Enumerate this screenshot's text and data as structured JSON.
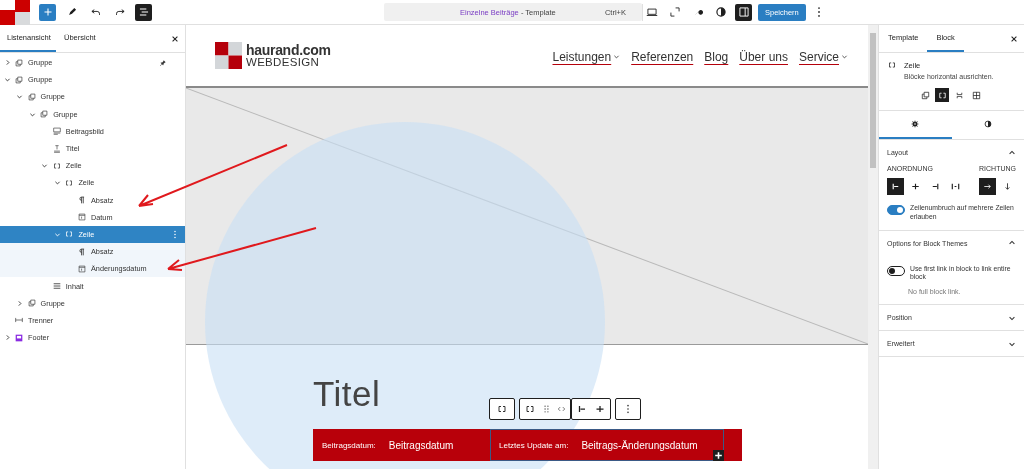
{
  "top_bar": {
    "left_tools": [
      {
        "kind": "add",
        "pressed": false
      },
      {
        "kind": "edit",
        "pressed": false
      },
      {
        "kind": "undo",
        "pressed": false
      },
      {
        "kind": "redo",
        "pressed": false
      },
      {
        "kind": "list_view",
        "pressed": true
      }
    ],
    "command": {
      "name": "Einzelne Beiträge",
      "type": "- Template",
      "shortcut": "Ctrl+K"
    },
    "right_tools": [
      {
        "kind": "desktop",
        "pressed": false
      },
      {
        "kind": "external",
        "pressed": false
      },
      {
        "kind": "tools",
        "pressed": false
      },
      {
        "kind": "styles",
        "pressed": false
      },
      {
        "kind": "sidebar",
        "pressed": true
      }
    ],
    "save": "Speichern"
  },
  "list_panel": {
    "tabs": [
      {
        "label": "Listenansicht",
        "selected": true
      },
      {
        "label": "Übersicht",
        "selected": false
      }
    ],
    "tree": [
      {
        "label": "Gruppe",
        "kind": "group",
        "expanded": false,
        "selected": false,
        "pinned": true
      },
      {
        "label": "Gruppe",
        "kind": "group",
        "expanded": true,
        "selected": false,
        "pinned": false,
        "children": [
          {
            "label": "Gruppe",
            "kind": "group",
            "expanded": true,
            "selected": false,
            "children": [
              {
                "label": "Gruppe",
                "kind": "group",
                "expanded": true,
                "selected": false,
                "children": [
                  {
                    "label": "Beitragsbild",
                    "kind": "image",
                    "selected": false
                  },
                  {
                    "label": "Titel",
                    "kind": "title",
                    "selected": false
                  },
                  {
                    "label": "Zeile",
                    "kind": "row",
                    "expanded": true,
                    "selected": false,
                    "children": [
                      {
                        "label": "Zeile",
                        "kind": "row",
                        "expanded": true,
                        "selected": false,
                        "children": [
                          {
                            "label": "Absatz",
                            "kind": "paragraph",
                            "selected": false
                          },
                          {
                            "label": "Datum",
                            "kind": "date",
                            "selected": false
                          }
                        ]
                      },
                      {
                        "label": "Zeile",
                        "kind": "row",
                        "expanded": true,
                        "selected": true,
                        "children": [
                          {
                            "label": "Absatz",
                            "kind": "paragraph",
                            "selected": false
                          },
                          {
                            "label": "Änderungsdatum",
                            "kind": "date",
                            "selected": false
                          }
                        ]
                      }
                    ]
                  },
                  {
                    "label": "Inhalt",
                    "kind": "content",
                    "selected": false
                  }
                ]
              }
            ]
          },
          {
            "label": "Gruppe",
            "kind": "group",
            "expanded": false,
            "selected": false
          }
        ]
      },
      {
        "label": "Trenner",
        "kind": "separator",
        "selected": false,
        "pinned": false
      },
      {
        "label": "Footer",
        "kind": "footer",
        "expanded": false,
        "selected": false,
        "pinned": false
      }
    ]
  },
  "canvas": {
    "site": {
      "logo_name": "haurand.com",
      "logo_tagline": "WEBDESIGN",
      "nav": [
        {
          "label": "Leistungen",
          "submenu": true
        },
        {
          "label": "Referenzen",
          "submenu": false
        },
        {
          "label": "Blog",
          "submenu": false
        },
        {
          "label": "Über uns",
          "submenu": false
        },
        {
          "label": "Service",
          "submenu": true
        }
      ]
    },
    "post": {
      "title": "Titel",
      "meta": [
        {
          "label": "Beitragsdatum:",
          "value": "Beitragsdatum",
          "selected": false
        },
        {
          "label": "Letztes Update am:",
          "value": "Beitrags-Änderungsdatum",
          "selected": true
        }
      ]
    }
  },
  "sidebar": {
    "tabs": [
      {
        "label": "Template",
        "selected": false
      },
      {
        "label": "Block",
        "selected": true
      }
    ],
    "block": {
      "name": "Zeile",
      "description": "Blöcke horizontal ausrichten."
    },
    "variations": [
      {
        "kind": "group",
        "selected": false
      },
      {
        "kind": "row",
        "selected": true
      },
      {
        "kind": "stack",
        "selected": false
      },
      {
        "kind": "grid",
        "selected": false
      }
    ],
    "inspector_tabs": [
      {
        "kind": "settings",
        "selected": true
      },
      {
        "kind": "styles",
        "selected": false
      }
    ],
    "panels": [
      {
        "kind": "layout",
        "title": "Layout",
        "expanded": true,
        "justification": {
          "label": "ANORDNUNG",
          "options": [
            {
              "kind": "left",
              "selected": true
            },
            {
              "kind": "center",
              "selected": false
            },
            {
              "kind": "right",
              "selected": false
            },
            {
              "kind": "space_between",
              "selected": false
            }
          ]
        },
        "orientation": {
          "label": "RICHTUNG",
          "options": [
            {
              "kind": "horizontal",
              "selected": true
            },
            {
              "kind": "vertical",
              "selected": false
            }
          ]
        },
        "toggle": {
          "label": "Zeilenumbruch auf mehrere Zeilen erlauben",
          "on": true
        }
      },
      {
        "kind": "link_options",
        "title": "Options for Block Themes",
        "expanded": true,
        "toggle": {
          "label": "Use first link in block to link entire block",
          "on": false
        },
        "help": "No full block link."
      },
      {
        "title": "Position",
        "expanded": false
      },
      {
        "title": "Erweitert",
        "expanded": false
      }
    ]
  }
}
